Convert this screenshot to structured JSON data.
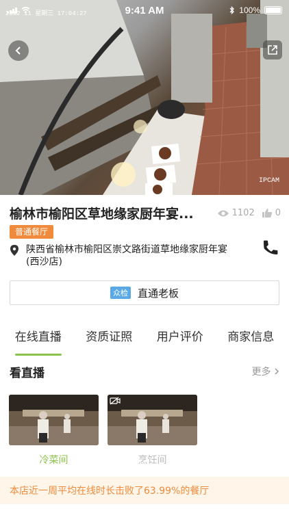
{
  "status_bar": {
    "overlay_text": "2012 11  星期三  17:04:27",
    "time": "9:41 AM",
    "battery": "100%"
  },
  "camera": {
    "watermark": "IPCAM"
  },
  "shop": {
    "title": "榆林市榆阳区草地缘家厨年宴...",
    "views": "1102",
    "likes": "0",
    "category_badge": "普通餐厅",
    "address": "陕西省榆林市榆阳区崇文路街道草地缘家厨年宴(西沙店)"
  },
  "direct": {
    "tag": "众检",
    "label": "直通老板"
  },
  "tabs": [
    {
      "label": "在线直播",
      "active": true
    },
    {
      "label": "资质证照",
      "active": false
    },
    {
      "label": "用户评价",
      "active": false
    },
    {
      "label": "商家信息",
      "active": false
    }
  ],
  "live": {
    "section_title": "看直播",
    "more_label": "更多",
    "cards": [
      {
        "label": "冷菜间",
        "color": "#8bc34a",
        "offline": false
      },
      {
        "label": "烹饪间",
        "color": "#bbbbbb",
        "offline": true
      }
    ]
  },
  "footer": {
    "text": "本店近一周平均在线时长击败了63.99%的餐厅"
  },
  "colors": {
    "accent_green": "#8bc34a",
    "accent_orange": "#f08a3c",
    "tag_blue": "#5aa9e6"
  }
}
